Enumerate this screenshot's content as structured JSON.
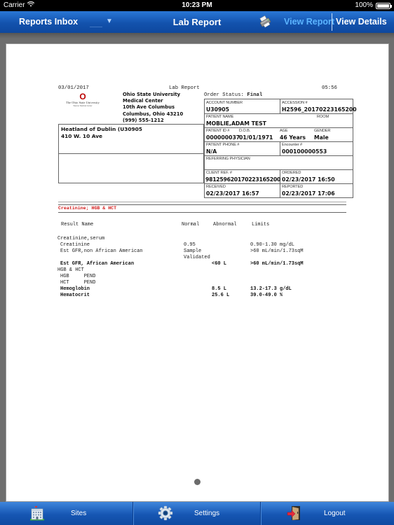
{
  "status_bar": {
    "carrier": "Carrier",
    "time": "10:23 PM",
    "battery": "100%",
    "battery_level": 1.0
  },
  "nav": {
    "inbox_label": "Reports Inbox",
    "dropdown_glyph": "▼",
    "title": "Lab Report",
    "print_icon": "printer-icon",
    "view_report": "View Report",
    "view_details": "View Details"
  },
  "colors": {
    "nav_blue": "#1352ad",
    "active_tab": "#5bb4ff",
    "section_red": "#d21b1b"
  },
  "report": {
    "date": "03/01/2017",
    "doc_title": "Lab Report",
    "time": "05:56",
    "logo": {
      "mark": "O",
      "name": "The Ohio State University",
      "sub": "Wexner Medical Center"
    },
    "institution": [
      "Ohio State University",
      "Medical Center",
      "10th Ave Columbus",
      "Columbus, Ohio 43210",
      "(999) 555-1212"
    ],
    "order_status_label": "Order Status:",
    "order_status": "Final",
    "client": {
      "line1": "Heatland of Dublin (U30905",
      "line2": "410 W. 10 Ave"
    },
    "fields": {
      "account_number_label": "ACCOUNT NUMBER",
      "account_number": "U30905",
      "accession_label": "ACCESSION #",
      "accession": "H2596_20170223165200",
      "patient_name_label": "PATIENT NAME",
      "patient_name": "MOBLIE,ADAM TEST",
      "room_label": "ROOM",
      "room": "",
      "patient_id_label": "PATIENT ID #",
      "patient_id": "000000037",
      "dob_label": "D.O.B.",
      "dob": "01/01/1971",
      "age_label": "AGE",
      "age": "46 Years",
      "gender_label": "GENDER",
      "gender": "Male",
      "patient_phone_label": "PATIENT PHONE #",
      "patient_phone": "N/A",
      "encounter_label": "Encounter #",
      "encounter": "000100000553",
      "referring_label": "REFERRING PHYSICIAN",
      "referring": "",
      "client_ref_label": "CLIENT REF. #",
      "client_ref": "98125962017022316520​0",
      "ordered_label": "ORDERED",
      "ordered": "02/23/2017 16:50",
      "received_label": "RECEIVED",
      "received": "02/23/2017 16:57",
      "reported_label": "REPORTED",
      "reported": "02/23/2017 17:06"
    },
    "section_title": "Creatinine; HGB & HCT",
    "columns": {
      "name": "Result Name",
      "normal": "Normal",
      "abnormal": "Abnormal",
      "limits": "Limits"
    },
    "results": [
      {
        "name": "Creatinine,serum",
        "normal": "",
        "abnormal": "",
        "limits": "",
        "indent": 0,
        "bold": false
      },
      {
        "name": "Creatinine",
        "normal": "0.95",
        "abnormal": "",
        "limits": "0.90-1.30 mg/dL",
        "indent": 1,
        "bold": false
      },
      {
        "name": "Est GFR,non African American",
        "normal": "Sample",
        "normal2": "Validated",
        "abnormal": "",
        "limits": ">60 mL/min/1.73sqM",
        "indent": 1,
        "bold": false
      },
      {
        "name": "Est GFR, African American",
        "normal": "",
        "abnormal": "<60 L",
        "limits": ">60 mL/min/1.73sqM",
        "indent": 1,
        "bold": true
      },
      {
        "name": "HGB & HCT",
        "normal": "",
        "abnormal": "",
        "limits": "",
        "indent": 0,
        "bold": false
      },
      {
        "name": "HGB     PEND",
        "normal": "",
        "abnormal": "",
        "limits": "",
        "indent": 1,
        "bold": false
      },
      {
        "name": "HCT     PEND",
        "normal": "",
        "abnormal": "",
        "limits": "",
        "indent": 1,
        "bold": false
      },
      {
        "name": "Hemoglobin",
        "normal": "",
        "abnormal": "8.5 L",
        "limits": "13.2-17.3 g/dL",
        "indent": 1,
        "bold": true
      },
      {
        "name": "Hematocrit",
        "normal": "",
        "abnormal": "25.6 L",
        "limits": "39.0-49.0 %",
        "indent": 1,
        "bold": true
      }
    ],
    "page_indicator": {
      "current": 1,
      "total": 1
    }
  },
  "tabs": [
    {
      "label": "Sites",
      "icon": "building-icon"
    },
    {
      "label": "Settings",
      "icon": "gear-icon"
    },
    {
      "label": "Logout",
      "icon": "logout-door-icon"
    }
  ]
}
